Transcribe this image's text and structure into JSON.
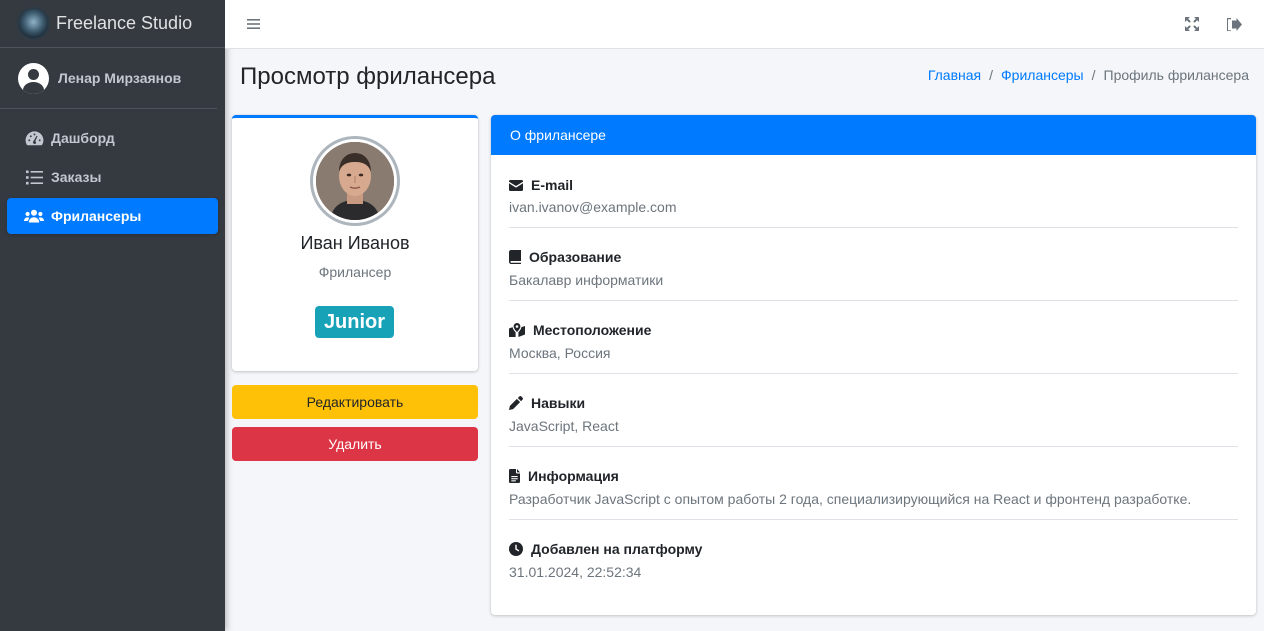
{
  "brand": {
    "name": "Freelance Studio"
  },
  "user": {
    "name": "Ленар Мирзаянов"
  },
  "sidebar": {
    "items": [
      {
        "label": "Дашборд",
        "icon": "tachometer-icon",
        "active": false
      },
      {
        "label": "Заказы",
        "icon": "list-icon",
        "active": false
      },
      {
        "label": "Фрилансеры",
        "icon": "users-icon",
        "active": true
      }
    ]
  },
  "topbar": {
    "menu_icon": "bars-icon",
    "fullscreen_icon": "expand-icon",
    "logout_icon": "sign-out-icon"
  },
  "page": {
    "title": "Просмотр фрилансера"
  },
  "breadcrumb": {
    "home": "Главная",
    "freelancers": "Фрилансеры",
    "current": "Профиль фрилансера",
    "separator": "/"
  },
  "profile": {
    "name": "Иван Иванов",
    "role": "Фрилансер",
    "level": "Junior",
    "edit_label": "Редактировать",
    "delete_label": "Удалить"
  },
  "info": {
    "header": "О фрилансере",
    "email": {
      "label": "E-mail",
      "value": "ivan.ivanov@example.com"
    },
    "education": {
      "label": "Образование",
      "value": "Бакалавр информатики"
    },
    "location": {
      "label": "Местоположение",
      "value": "Москва, Россия"
    },
    "skills": {
      "label": "Навыки",
      "value": "JavaScript, React"
    },
    "about": {
      "label": "Информация",
      "value": "Разработчик JavaScript с опытом работы 2 года, специализирующийся на React и фронтенд разработке."
    },
    "created": {
      "label": "Добавлен на платформу",
      "value": "31.01.2024, 22:52:34"
    }
  },
  "colors": {
    "primary": "#007bff",
    "sidebar": "#343a40",
    "warning": "#ffc107",
    "danger": "#dc3545",
    "info": "#17a2b8"
  }
}
